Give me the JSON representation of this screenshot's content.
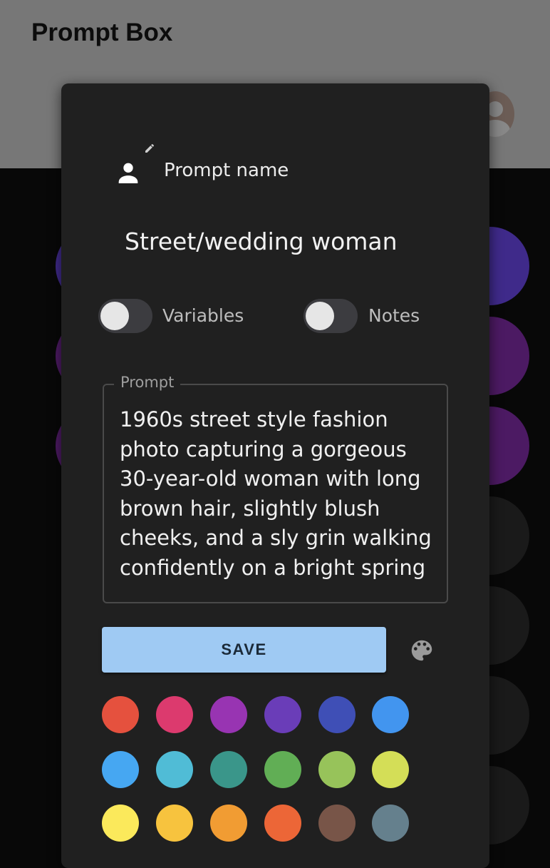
{
  "app": {
    "title": "Prompt Box"
  },
  "dialog": {
    "name_label": "Prompt name",
    "name_value": "Street/wedding woman",
    "variables_label": "Variables",
    "notes_label": "Notes",
    "variables_on": false,
    "notes_on": false,
    "prompt_label": "Prompt",
    "prompt_text": "1960s street style fashion photo capturing a gorgeous 30-year-old woman with long brown hair, slightly blush cheeks, and a sly grin walking confidently on a bright spring",
    "save_label": "SAVE",
    "icons": [
      "person-icon",
      "pencil-icon",
      "palette-icon"
    ]
  },
  "colors": {
    "swatches": [
      "#e5513e",
      "#dc3a6e",
      "#9834b2",
      "#6a3db8",
      "#3f4fb6",
      "#4295ef",
      "#46a7f2",
      "#50bcd6",
      "#3a968a",
      "#61ae55",
      "#97c35a",
      "#d4de57",
      "#fbe95b",
      "#f7c33e",
      "#f19c33",
      "#ec6637",
      "#785548",
      "#65808d"
    ],
    "background_items": [
      "#3f2a8a",
      "#4c1a63",
      "#4c1a63",
      "#1a1a1a",
      "#1a1a1a",
      "#1a1a1a",
      "#1a1a1a"
    ],
    "save_button": "#9fcaf3"
  }
}
